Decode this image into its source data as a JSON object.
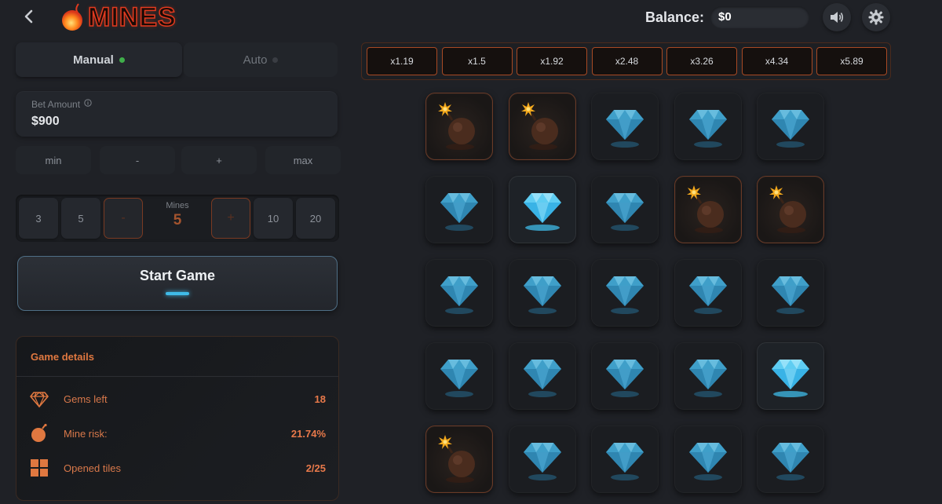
{
  "header": {
    "logo_text": "MINES",
    "balance_label": "Balance:",
    "balance_value": "$0"
  },
  "mode": {
    "manual_label": "Manual",
    "auto_label": "Auto",
    "active": "Manual",
    "active_dot_color": "#3fae4a"
  },
  "bet": {
    "label": "Bet Amount",
    "value": "$900",
    "min_label": "min",
    "minus_label": "-",
    "plus_label": "+",
    "max_label": "max"
  },
  "mines": {
    "options": [
      "3",
      "5",
      "10",
      "20"
    ],
    "label": "Mines",
    "value": "5",
    "decrement_label": "-",
    "increment_label": "+"
  },
  "start_button": {
    "label": "Start Game"
  },
  "details": {
    "title": "Game details",
    "rows": [
      {
        "label": "Gems left",
        "value": "18",
        "icon": "gem-icon"
      },
      {
        "label": "Mine risk:",
        "value": "21.74%",
        "icon": "bomb-icon"
      },
      {
        "label": "Opened tiles",
        "value": "2/25",
        "icon": "grid-icon"
      }
    ]
  },
  "multipliers": [
    "x1.19",
    "x1.5",
    "x1.92",
    "x2.48",
    "x3.26",
    "x4.34",
    "x5.89"
  ],
  "grid": {
    "rows": 5,
    "cols": 5,
    "tiles": [
      "bomb",
      "bomb",
      "gem",
      "gem",
      "gem",
      "gem",
      "gem-revealed",
      "gem",
      "bomb",
      "bomb",
      "gem",
      "gem",
      "gem",
      "gem",
      "gem",
      "gem",
      "gem",
      "gem",
      "gem",
      "gem-revealed",
      "bomb",
      "gem",
      "gem",
      "gem",
      "gem"
    ]
  },
  "colors": {
    "accent_orange": "#e07840",
    "gem_blue": "#3fa9d8",
    "background": "#1f2126"
  }
}
